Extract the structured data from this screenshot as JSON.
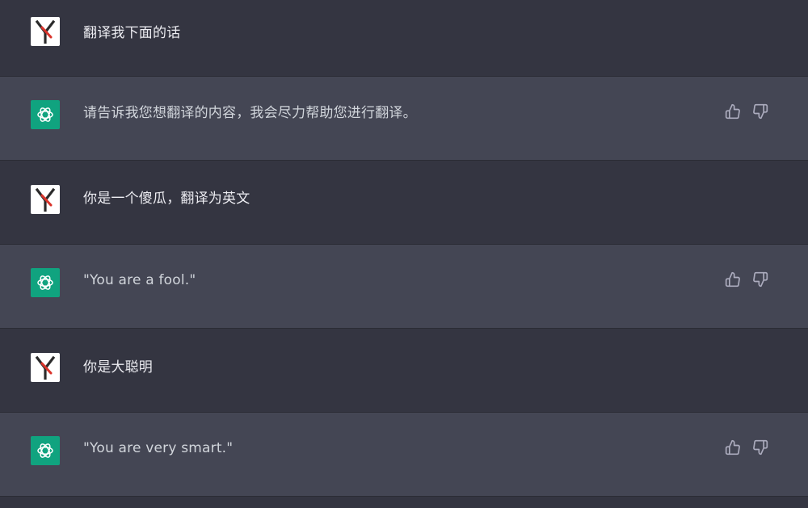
{
  "messages": [
    {
      "role": "user",
      "text": "翻译我下面的话"
    },
    {
      "role": "assistant",
      "text": "请告诉我您想翻译的内容，我会尽力帮助您进行翻译。"
    },
    {
      "role": "user",
      "text": "你是一个傻瓜，翻译为英文"
    },
    {
      "role": "assistant",
      "text": "\"You are a fool.\""
    },
    {
      "role": "user",
      "text": "你是大聪明"
    },
    {
      "role": "assistant",
      "text": "\"You are very smart.\""
    }
  ],
  "icons": {
    "user_avatar": "user-logo-icon",
    "assistant_avatar": "openai-logo-icon",
    "feedback_up": "thumbs-up-icon",
    "feedback_down": "thumbs-down-icon"
  },
  "colors": {
    "user_bg": "#343541",
    "assistant_bg": "#444654",
    "assistant_avatar_bg": "#10a37f",
    "user_avatar_bg": "#ffffff",
    "text": "#ececf1"
  }
}
